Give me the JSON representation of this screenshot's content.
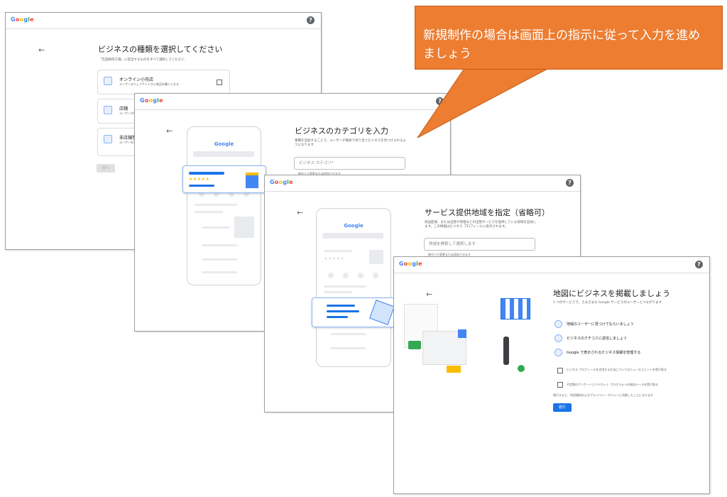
{
  "logo_text": "Google",
  "help_icon_glyph": "?",
  "callout": {
    "text": "新規制作の場合は画面上の指示に従って入力を進めましょう",
    "color": "#ed7d31"
  },
  "screen1": {
    "title": "ビジネスの種類を選択してください",
    "subtitle": "「吉田焼肉工場」に該当するものをすべて選択してください",
    "options": [
      {
        "label": "オンライン小売店",
        "desc": "ユーザーはウェブサイトから商品を購入できる"
      },
      {
        "label": "店舗",
        "desc": "ユーザーが来店できる"
      },
      {
        "label": "非店舗型",
        "desc": "ユーザー先を訪問する"
      }
    ],
    "next_label": "次へ"
  },
  "screen2": {
    "title": "ビジネスのカテゴリを入力",
    "desc": "業種を追加することで、ユーザーが検索で有り合うビジネスを見つけられるようになります",
    "input_placeholder": "ビジネス カテゴリ*",
    "hint": "後からで変更または追加できます",
    "phone_logo": "Google",
    "stars": "★★★★★"
  },
  "screen3": {
    "title": "サービス提供地域を指定（省略可）",
    "desc": "商品配達、または出張や修理などの出張サービスを提供している地域を追加します。この情報はビジネス プロフィールに表示されます。",
    "input_placeholder": "地域を検索して選択します",
    "hint": "後からで変更または追加できます",
    "phone_logo": "Google",
    "stars": "★★★★★"
  },
  "screen4": {
    "title": "地図にビジネスを掲載しましょう",
    "desc": "1 つのサービスで、さまざまな Google サービスのユーザーとつながります",
    "features": [
      "地域のユーザーに見つけてもらいましょう",
      "ビジネスのクチコミに返信しましょう",
      "Google で表示されるビジネス情報を管理する"
    ],
    "checkboxes": [
      "ビジネス プロフィールを活用する方法についてのニュースとヒントを受け取る",
      "不定期のアンケートとパイロット プログラムへの参加メールを受け取る"
    ],
    "terms": "続行すると、利用規約およびプライバシー ポリシーに同意したことになります",
    "next_label": "続行"
  }
}
